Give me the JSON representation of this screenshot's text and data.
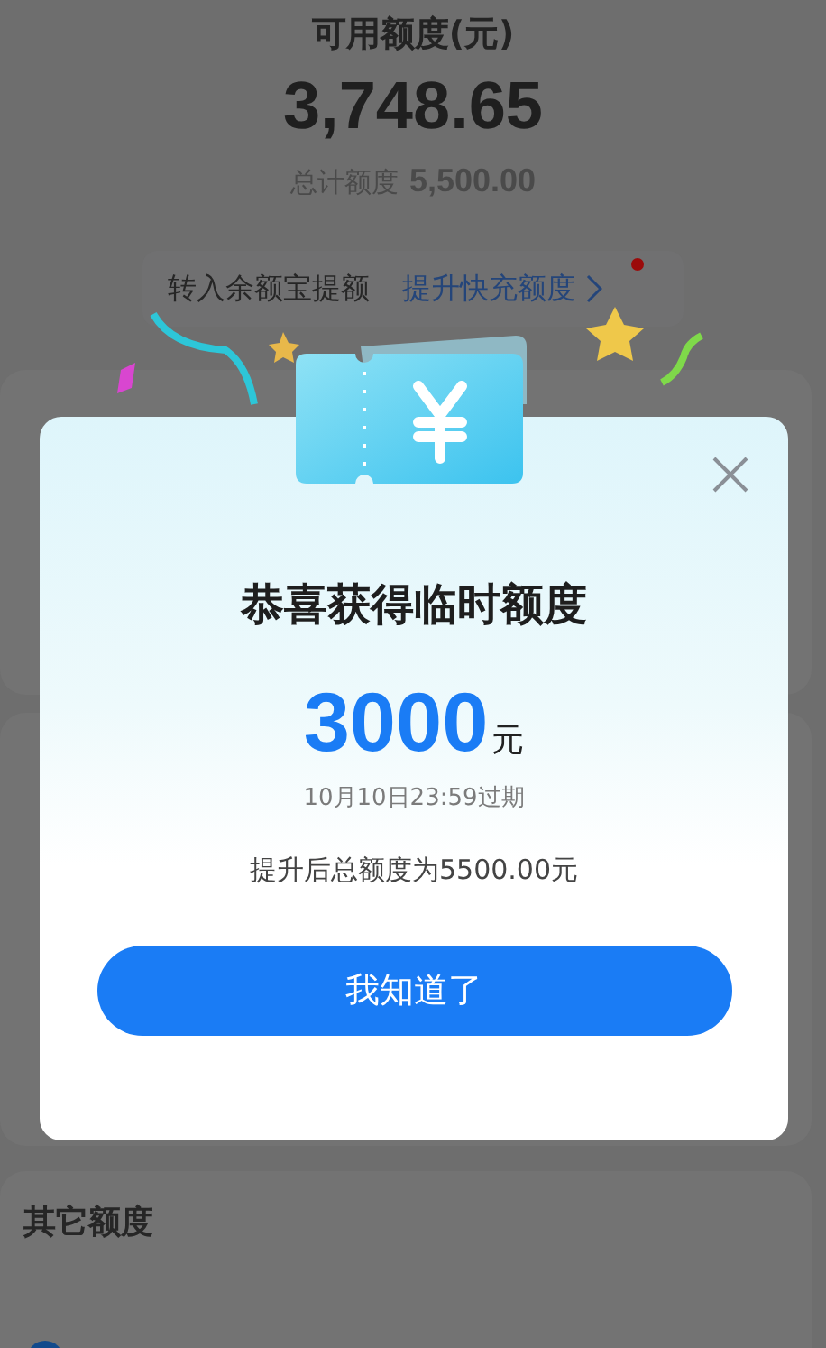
{
  "balance": {
    "label": "可用额度(元)",
    "amount": "3,748.65",
    "total_label": "总计额度",
    "total_amount": "5,500.00"
  },
  "banner": {
    "text": "转入余额宝提额",
    "link": "提升快充额度",
    "has_dot": true
  },
  "other_section": {
    "title": "其它额度"
  },
  "dialog": {
    "title": "恭喜获得临时额度",
    "amount": "3000",
    "unit": "元",
    "expiry": "10月10日23:59过期",
    "note": "提升后总额度为5500.00元",
    "button": "我知道了"
  }
}
